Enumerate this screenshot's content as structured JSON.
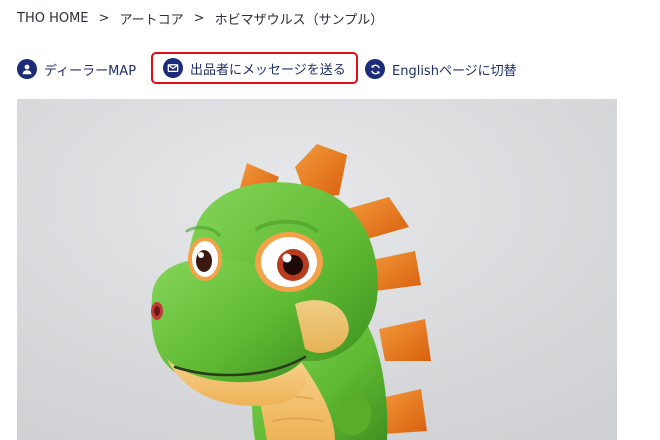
{
  "breadcrumb": {
    "home": "THO HOME",
    "separator": ">",
    "category": "アートコア",
    "current": "ホビマザウルス（サンプル）"
  },
  "actions": {
    "dealer_map": {
      "label": "ディーラーMAP",
      "icon": "person-icon"
    },
    "message": {
      "label": "出品者にメッセージを送る",
      "icon": "envelope-icon"
    },
    "english": {
      "label": "Englishページに切替",
      "icon": "refresh-icon"
    }
  },
  "photo": {
    "subject": "green dinosaur plush toy"
  },
  "colors": {
    "link": "#1f2f6b",
    "icon_bg": "#1c2b7a",
    "highlight_border": "#e00d17",
    "plush_green": "#6cc43c",
    "plush_orange": "#f07a1a"
  }
}
